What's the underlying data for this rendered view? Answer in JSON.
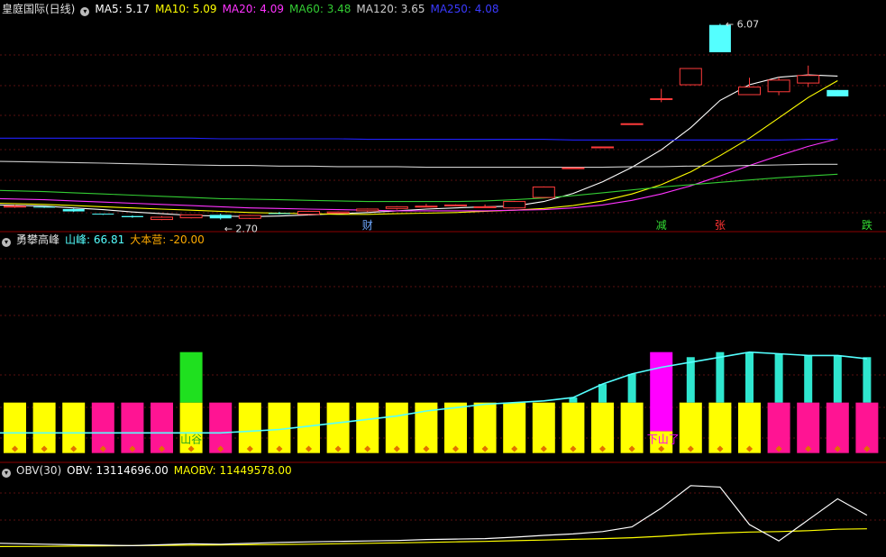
{
  "colors": {
    "background": "#000000",
    "up_candle": "#ff3b3b",
    "down_candle": "#54ffff",
    "ma5": "#ffffff",
    "ma10": "#ffff00",
    "ma20": "#ff33ff",
    "ma60": "#33cc33",
    "ma120": "#cccccc",
    "ma250": "#2020ff",
    "bar_yellow": "#ffff00",
    "bar_magenta": "#ff1493",
    "bar_green": "#1fe01f",
    "bar_violet": "#ff00ff",
    "bar_cyan": "#2fe6cf",
    "obv": "#ffffff",
    "maobv": "#ffff00"
  },
  "panel1": {
    "title": "皇庭国际(日线)",
    "ma5_label": "MA5: 5.17",
    "ma10_label": "MA10: 5.09",
    "ma20_label": "MA20: 4.09",
    "ma60_label": "MA60: 3.48",
    "ma120_label": "MA120: 3.65",
    "ma250_label": "MA250: 4.08",
    "high_label": "6.07",
    "low_label": "2.70",
    "markers": [
      {
        "text": "财",
        "color": "#6fa8ff",
        "index": 12
      },
      {
        "text": "减",
        "color": "#33dd33",
        "index": 22
      },
      {
        "text": "张",
        "color": "#ff3333",
        "index": 24
      },
      {
        "text": "跌",
        "color": "#33dd33",
        "index": 29
      }
    ]
  },
  "panel2": {
    "title": "勇攀高峰",
    "shanfeng_label": "山峰: 66.81",
    "dabenying_label": "大本营: -20.00",
    "valley_label": "山谷",
    "downhill_label": "下山了"
  },
  "panel3": {
    "title": "OBV(30)",
    "obv_label": "OBV: 13114696.00",
    "maobv_label": "MAOBV: 11449578.00"
  },
  "chart_data": [
    {
      "type": "candlestick",
      "title": "皇庭国际(日线)",
      "ylim": [
        2.6,
        6.2
      ],
      "candles": [
        {
          "o": 2.92,
          "h": 2.95,
          "l": 2.9,
          "c": 2.93
        },
        {
          "o": 2.92,
          "h": 2.93,
          "l": 2.9,
          "c": 2.91
        },
        {
          "o": 2.88,
          "h": 2.89,
          "l": 2.83,
          "c": 2.84
        },
        {
          "o": 2.8,
          "h": 2.8,
          "l": 2.78,
          "c": 2.79
        },
        {
          "o": 2.76,
          "h": 2.77,
          "l": 2.73,
          "c": 2.74
        },
        {
          "o": 2.7,
          "h": 2.76,
          "l": 2.69,
          "c": 2.74
        },
        {
          "o": 2.73,
          "h": 2.79,
          "l": 2.72,
          "c": 2.78
        },
        {
          "o": 2.78,
          "h": 2.8,
          "l": 2.7,
          "c": 2.72
        },
        {
          "o": 2.72,
          "h": 2.78,
          "l": 2.71,
          "c": 2.77
        },
        {
          "o": 2.81,
          "h": 2.83,
          "l": 2.79,
          "c": 2.8
        },
        {
          "o": 2.79,
          "h": 2.85,
          "l": 2.78,
          "c": 2.84
        },
        {
          "o": 2.81,
          "h": 2.84,
          "l": 2.8,
          "c": 2.83
        },
        {
          "o": 2.85,
          "h": 2.89,
          "l": 2.83,
          "c": 2.88
        },
        {
          "o": 2.89,
          "h": 2.93,
          "l": 2.87,
          "c": 2.92
        },
        {
          "o": 2.92,
          "h": 2.97,
          "l": 2.91,
          "c": 2.93
        },
        {
          "o": 2.95,
          "h": 2.96,
          "l": 2.93,
          "c": 2.95
        },
        {
          "o": 2.92,
          "h": 2.96,
          "l": 2.91,
          "c": 2.92
        },
        {
          "o": 2.9,
          "h": 3.02,
          "l": 2.89,
          "c": 3.01
        },
        {
          "o": 3.08,
          "h": 3.27,
          "l": 3.07,
          "c": 3.26
        },
        {
          "o": 3.59,
          "h": 3.59,
          "l": 3.59,
          "c": 3.59
        },
        {
          "o": 3.95,
          "h": 3.95,
          "l": 3.95,
          "c": 3.95
        },
        {
          "o": 4.35,
          "h": 4.35,
          "l": 4.35,
          "c": 4.35
        },
        {
          "o": 4.78,
          "h": 4.95,
          "l": 4.72,
          "c": 4.78
        },
        {
          "o": 5.02,
          "h": 5.3,
          "l": 5.02,
          "c": 5.3
        },
        {
          "o": 6.05,
          "h": 6.07,
          "l": 5.58,
          "c": 5.58
        },
        {
          "o": 4.85,
          "h": 5.14,
          "l": 4.85,
          "c": 4.98
        },
        {
          "o": 4.9,
          "h": 5.15,
          "l": 4.84,
          "c": 5.1
        },
        {
          "o": 5.05,
          "h": 5.35,
          "l": 4.98,
          "c": 5.18
        },
        {
          "o": 4.93,
          "h": 4.93,
          "l": 4.82,
          "c": 4.82
        }
      ],
      "ma": [
        {
          "name": "MA5",
          "color": "#ffffff",
          "values": [
            2.95,
            2.93,
            2.9,
            2.87,
            2.83,
            2.8,
            2.77,
            2.76,
            2.75,
            2.76,
            2.78,
            2.8,
            2.82,
            2.85,
            2.88,
            2.9,
            2.92,
            2.93,
            3.01,
            3.15,
            3.35,
            3.6,
            3.9,
            4.28,
            4.75,
            5.02,
            5.15,
            5.19,
            5.17
          ]
        },
        {
          "name": "MA10",
          "color": "#ffff00",
          "values": [
            2.98,
            2.96,
            2.94,
            2.92,
            2.9,
            2.88,
            2.86,
            2.84,
            2.82,
            2.81,
            2.8,
            2.79,
            2.79,
            2.8,
            2.81,
            2.82,
            2.84,
            2.86,
            2.89,
            2.94,
            3.02,
            3.14,
            3.3,
            3.52,
            3.8,
            4.1,
            4.45,
            4.8,
            5.09
          ]
        },
        {
          "name": "MA20",
          "color": "#ff33ff",
          "values": [
            3.06,
            3.04,
            3.02,
            3.0,
            2.98,
            2.96,
            2.94,
            2.92,
            2.9,
            2.89,
            2.88,
            2.87,
            2.86,
            2.85,
            2.85,
            2.85,
            2.85,
            2.86,
            2.87,
            2.9,
            2.95,
            3.03,
            3.14,
            3.28,
            3.45,
            3.63,
            3.8,
            3.96,
            4.09
          ]
        },
        {
          "name": "MA60",
          "color": "#33cc33",
          "values": [
            3.2,
            3.18,
            3.16,
            3.14,
            3.12,
            3.1,
            3.08,
            3.06,
            3.05,
            3.04,
            3.03,
            3.02,
            3.01,
            3.01,
            3.01,
            3.01,
            3.02,
            3.04,
            3.07,
            3.11,
            3.16,
            3.21,
            3.26,
            3.3,
            3.34,
            3.38,
            3.42,
            3.45,
            3.48
          ]
        },
        {
          "name": "MA120",
          "color": "#cccccc",
          "values": [
            3.7,
            3.69,
            3.68,
            3.67,
            3.66,
            3.65,
            3.64,
            3.63,
            3.63,
            3.62,
            3.62,
            3.61,
            3.61,
            3.61,
            3.6,
            3.6,
            3.6,
            3.6,
            3.6,
            3.6,
            3.6,
            3.61,
            3.61,
            3.62,
            3.62,
            3.63,
            3.64,
            3.65,
            3.65
          ]
        },
        {
          "name": "MA250",
          "color": "#2020ff",
          "values": [
            4.1,
            4.1,
            4.1,
            4.1,
            4.1,
            4.1,
            4.1,
            4.09,
            4.09,
            4.09,
            4.09,
            4.09,
            4.08,
            4.08,
            4.08,
            4.08,
            4.08,
            4.08,
            4.08,
            4.07,
            4.07,
            4.07,
            4.07,
            4.07,
            4.07,
            4.07,
            4.07,
            4.08,
            4.08
          ]
        }
      ]
    },
    {
      "type": "bar",
      "title": "勇攀高峰",
      "ylim": [
        -35,
        100
      ],
      "baseline": 0,
      "base_bars": [
        {
          "low": -30,
          "high": 0,
          "color": "#ffff00"
        },
        {
          "low": -30,
          "high": 0,
          "color": "#ffff00"
        },
        {
          "low": -30,
          "high": 0,
          "color": "#ffff00"
        },
        {
          "low": -30,
          "high": 0,
          "color": "#ff1493"
        },
        {
          "low": -30,
          "high": 0,
          "color": "#ff1493"
        },
        {
          "low": -30,
          "high": 0,
          "color": "#ff1493"
        },
        {
          "low": -30,
          "high": 0,
          "color": "#ffff00"
        },
        {
          "low": -30,
          "high": 0,
          "color": "#ff1493"
        },
        {
          "low": -30,
          "high": 0,
          "color": "#ffff00"
        },
        {
          "low": -30,
          "high": 0,
          "color": "#ffff00"
        },
        {
          "low": -30,
          "high": 0,
          "color": "#ffff00"
        },
        {
          "low": -30,
          "high": 0,
          "color": "#ffff00"
        },
        {
          "low": -30,
          "high": 0,
          "color": "#ffff00"
        },
        {
          "low": -30,
          "high": 0,
          "color": "#ffff00"
        },
        {
          "low": -30,
          "high": 0,
          "color": "#ffff00"
        },
        {
          "low": -30,
          "high": 0,
          "color": "#ffff00"
        },
        {
          "low": -30,
          "high": 0,
          "color": "#ffff00"
        },
        {
          "low": -30,
          "high": 0,
          "color": "#ffff00"
        },
        {
          "low": -30,
          "high": 0,
          "color": "#ffff00"
        },
        {
          "low": -30,
          "high": 0,
          "color": "#ffff00"
        },
        {
          "low": -30,
          "high": 0,
          "color": "#ffff00"
        },
        {
          "low": -30,
          "high": 0,
          "color": "#ffff00"
        },
        {
          "low": -30,
          "high": -17,
          "color": "#ffff00"
        },
        {
          "low": -30,
          "high": 0,
          "color": "#ffff00"
        },
        {
          "low": -30,
          "high": 0,
          "color": "#ffff00"
        },
        {
          "low": -30,
          "high": 0,
          "color": "#ffff00"
        },
        {
          "low": -30,
          "high": 0,
          "color": "#ff1493"
        },
        {
          "low": -30,
          "high": 0,
          "color": "#ff1493"
        },
        {
          "low": -30,
          "high": 0,
          "color": "#ff1493"
        },
        {
          "low": -30,
          "high": 0,
          "color": "#ff1493"
        }
      ],
      "special_bars": [
        {
          "index": 6,
          "low": 0,
          "high": 30,
          "color": "#1fe01f"
        },
        {
          "index": 22,
          "low": -17,
          "high": 30,
          "color": "#ff00ff"
        }
      ],
      "cyan_bars": [
        0,
        0,
        0,
        0,
        0,
        0,
        0,
        0,
        0,
        0,
        0,
        0,
        0,
        0,
        0,
        0,
        0,
        0,
        0,
        3,
        11,
        17,
        24,
        27,
        30,
        30,
        29,
        28,
        28,
        27
      ],
      "line_shanfeng": [
        -18,
        -18,
        -18,
        -18,
        -18,
        -18,
        -18,
        -18,
        -17,
        -16,
        -14,
        -12,
        -10,
        -8,
        -5,
        -3,
        -1,
        0,
        1,
        3,
        11,
        17,
        21,
        24,
        27,
        30,
        29,
        28,
        28,
        26
      ]
    },
    {
      "type": "line",
      "title": "OBV(30)",
      "ylim": [
        0,
        15
      ],
      "series": [
        {
          "name": "OBV",
          "color": "#ffffff",
          "values": [
            1.0,
            0.8,
            0.7,
            0.6,
            0.5,
            0.7,
            0.9,
            0.8,
            1.0,
            1.2,
            1.3,
            1.4,
            1.5,
            1.6,
            1.8,
            1.9,
            2.0,
            2.3,
            2.7,
            3.0,
            3.5,
            4.5,
            8.5,
            13.3,
            13.0,
            5.0,
            1.5,
            6.0,
            10.5,
            7.0
          ]
        },
        {
          "name": "MAOBV",
          "color": "#ffff00",
          "values": [
            0.3,
            0.35,
            0.4,
            0.45,
            0.5,
            0.55,
            0.6,
            0.65,
            0.7,
            0.75,
            0.8,
            0.9,
            1.0,
            1.1,
            1.2,
            1.3,
            1.4,
            1.55,
            1.7,
            1.85,
            2.0,
            2.2,
            2.5,
            2.9,
            3.2,
            3.4,
            3.5,
            3.7,
            4.0,
            4.1
          ]
        }
      ]
    }
  ]
}
